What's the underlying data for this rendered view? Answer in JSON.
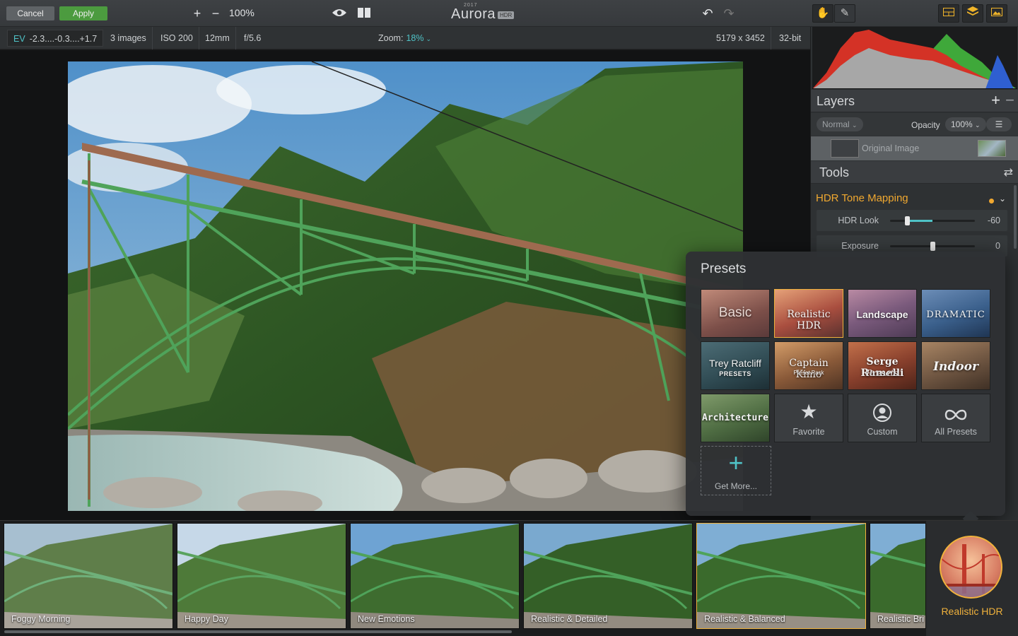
{
  "toolbar": {
    "cancel": "Cancel",
    "apply": "Apply",
    "zoom_percent": "100%",
    "logo_word": "Aurora",
    "logo_year": "2017",
    "logo_badge": "HDR"
  },
  "info": {
    "ev_label": "EV",
    "ev_values": "-2.3....-0.3....+1.7",
    "images": "3 images",
    "iso": "ISO 200",
    "focal": "12mm",
    "aperture": "f/5.6",
    "zoom_label": "Zoom:",
    "zoom_value": "18%",
    "dimensions": "5179 x 3452",
    "bit_depth": "32-bit"
  },
  "layers": {
    "title": "Layers",
    "blend_mode": "Normal",
    "opacity_label": "Opacity",
    "opacity_value": "100%",
    "layer_name": "Original Image"
  },
  "tools": {
    "title": "Tools",
    "section": "HDR Tone Mapping",
    "sliders": [
      {
        "label": "HDR Look",
        "value": "-60",
        "level": -0.6
      },
      {
        "label": "Exposure",
        "value": "0",
        "level": 0
      }
    ]
  },
  "presets": {
    "title": "Presets",
    "tiles": [
      {
        "label": "Basic"
      },
      {
        "label": "Realistic HDR",
        "selected": true
      },
      {
        "label": "Landscape"
      },
      {
        "label": "DRAMATIC"
      },
      {
        "label": "Trey Ratcliff",
        "sub": "PRESETS"
      },
      {
        "label": "Captain Kimo",
        "sub": "Preset Pack"
      },
      {
        "label": "Serge Ramelli",
        "sub": "Presets"
      },
      {
        "label": "Indoor"
      },
      {
        "label": "Architecture"
      }
    ],
    "categories": [
      {
        "label": "Favorite",
        "icon": "star-icon"
      },
      {
        "label": "Custom",
        "icon": "user-circle-icon"
      },
      {
        "label": "All Presets",
        "icon": "infinity-icon"
      }
    ],
    "get_more": "Get More..."
  },
  "filmstrip": {
    "items": [
      {
        "label": "Foggy Morning"
      },
      {
        "label": "Happy Day"
      },
      {
        "label": "New Emotions"
      },
      {
        "label": "Realistic & Detailed"
      },
      {
        "label": "Realistic & Balanced",
        "active": true
      },
      {
        "label": "Realistic Bri"
      }
    ],
    "category": "Realistic HDR"
  },
  "colors": {
    "accent_teal": "#4fc3c7",
    "accent_orange": "#f0a830",
    "apply_green": "#4c9b3f"
  }
}
